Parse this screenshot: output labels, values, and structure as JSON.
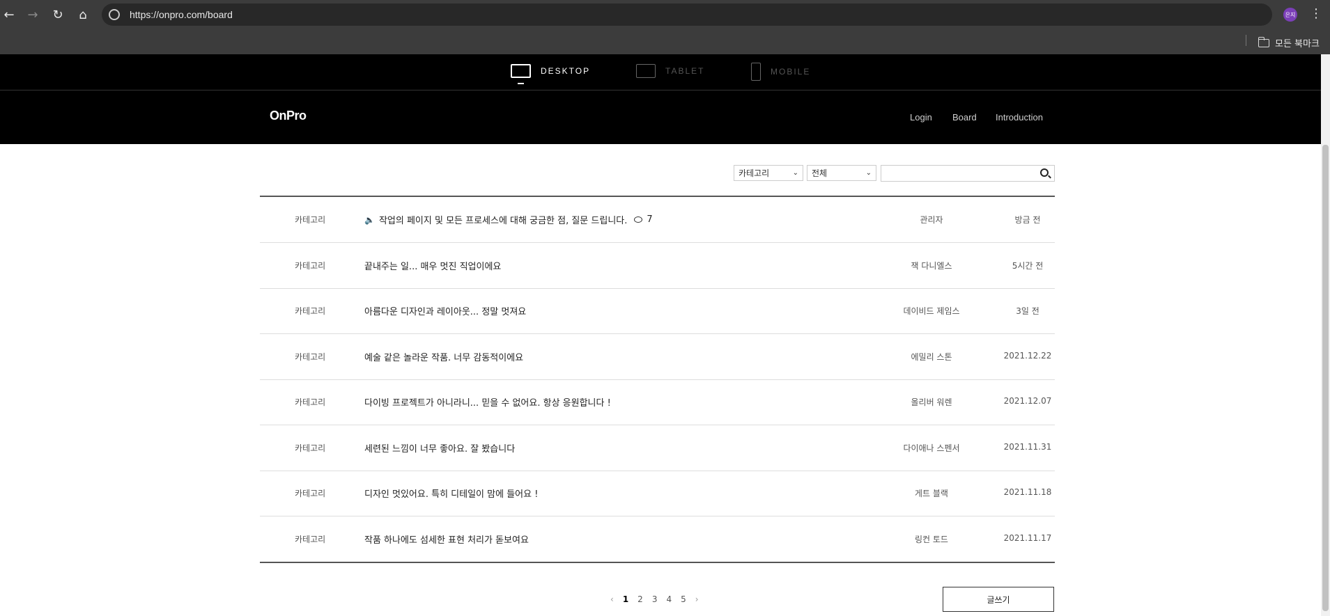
{
  "browser": {
    "url": "https://onpro.com/board",
    "profile_label": "은지",
    "bookmarks_label": "모든 북마크"
  },
  "devices": [
    {
      "label": "DESKTOP",
      "active": true
    },
    {
      "label": "TABLET",
      "active": false
    },
    {
      "label": "MOBILE",
      "active": false
    }
  ],
  "site": {
    "logo": "OnPro",
    "nav": [
      "Login",
      "Board",
      "Introduction"
    ]
  },
  "filters": {
    "category_select": "카테고리",
    "scope_select": "전체",
    "search_value": ""
  },
  "posts": [
    {
      "category": "카테고리",
      "title": "작업의 페이지 및 모든 프로세스에 대해 궁금한 점, 질문 드립니다.",
      "comments": "7",
      "author": "관리자",
      "date": "방금 전",
      "notice": true
    },
    {
      "category": "카테고리",
      "title": "끝내주는 일... 매우 멋진 직업이에요",
      "comments": "",
      "author": "잭 다니엘스",
      "date": "5시간 전",
      "notice": false
    },
    {
      "category": "카테고리",
      "title": "아름다운 디자인과 레이아웃... 정말 멋져요",
      "comments": "",
      "author": "데이비드 제임스",
      "date": "3일 전",
      "notice": false
    },
    {
      "category": "카테고리",
      "title": "예술 같은 놀라운 작품. 너무 감동적이에요",
      "comments": "",
      "author": "에밀리 스톤",
      "date": "2021.12.22",
      "notice": false
    },
    {
      "category": "카테고리",
      "title": "다이빙 프로젝트가 아니라니... 믿을 수 없어요. 항상 응원합니다 !",
      "comments": "",
      "author": "올리버 워렌",
      "date": "2021.12.07",
      "notice": false
    },
    {
      "category": "카테고리",
      "title": "세련된 느낌이 너무 좋아요. 잘 봤습니다",
      "comments": "",
      "author": "다이애나 스펜서",
      "date": "2021.11.31",
      "notice": false
    },
    {
      "category": "카테고리",
      "title": "디자인 멋있어요. 특히 디테일이 맘에 들어요 !",
      "comments": "",
      "author": "게트 블랙",
      "date": "2021.11.18",
      "notice": false
    },
    {
      "category": "카테고리",
      "title": "작품 하나에도 섬세한 표현 처리가 돋보여요",
      "comments": "",
      "author": "링컨 토드",
      "date": "2021.11.17",
      "notice": false
    }
  ],
  "pagination": {
    "prev": "‹",
    "pages": [
      "1",
      "2",
      "3",
      "4",
      "5"
    ],
    "current": "1",
    "next": "›"
  },
  "write_button": "글쓰기"
}
